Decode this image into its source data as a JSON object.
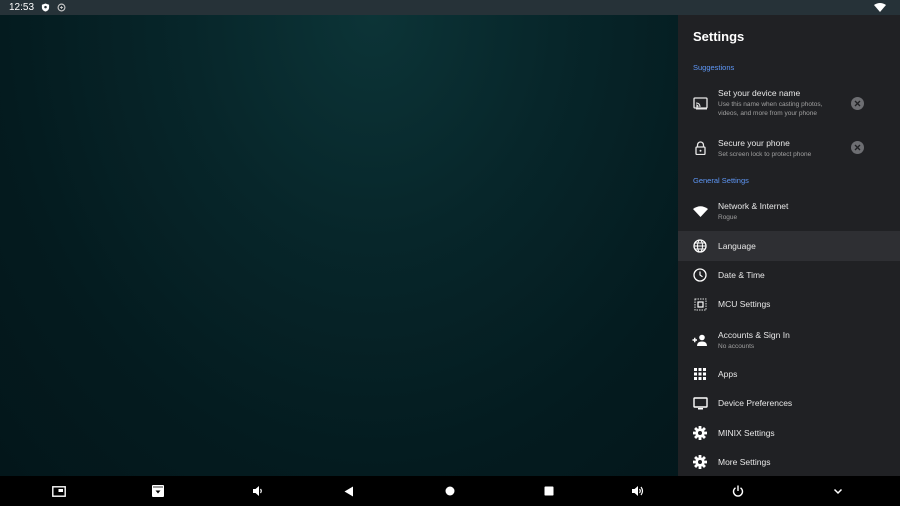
{
  "status_bar": {
    "time": "12:53",
    "icons": [
      "shield-icon",
      "data-saver-icon",
      "wifi-icon"
    ]
  },
  "settings": {
    "title": "Settings",
    "suggestions_header": "Suggestions",
    "suggestions": [
      {
        "icon": "cast-icon",
        "title": "Set your device name",
        "subtitle_line1": "Use this name when casting photos,",
        "subtitle_line2": "videos, and more from your phone",
        "dismiss_icon": "close-circle-icon"
      },
      {
        "icon": "lock-icon",
        "title": "Secure your phone",
        "subtitle_line1": "Set screen lock to protect phone",
        "dismiss_icon": "close-circle-icon"
      }
    ],
    "general_header": "General Settings",
    "items": [
      {
        "icon": "wifi-icon",
        "title": "Network & Internet",
        "subtitle": "Rogue"
      },
      {
        "icon": "globe-icon",
        "title": "Language",
        "focused": true
      },
      {
        "icon": "clock-icon",
        "title": "Date & Time"
      },
      {
        "icon": "chip-icon",
        "title": "MCU Settings"
      },
      {
        "icon": "add-person-icon",
        "title": "Accounts & Sign In",
        "subtitle": "No accounts"
      },
      {
        "icon": "apps-grid-icon",
        "title": "Apps"
      },
      {
        "icon": "monitor-icon",
        "title": "Device Preferences"
      },
      {
        "icon": "gear-icon",
        "title": "MINIX Settings"
      },
      {
        "icon": "gear-icon",
        "title": "More Settings"
      }
    ]
  },
  "nav_bar": {
    "buttons": [
      "picture-in-picture-icon",
      "screenshot-icon",
      "volume-down-icon",
      "back-icon",
      "home-icon",
      "recents-icon",
      "volume-up-icon",
      "power-icon",
      "chevron-down-icon"
    ]
  }
}
